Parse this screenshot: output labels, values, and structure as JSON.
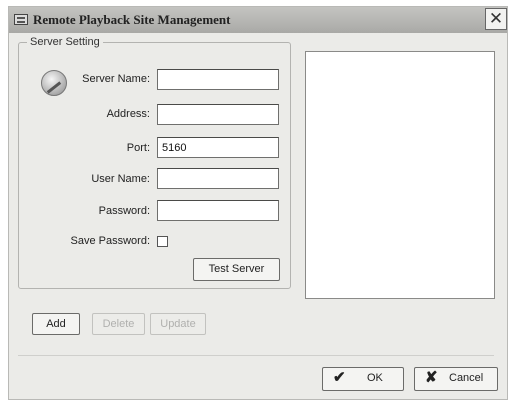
{
  "window": {
    "title": "Remote Playback Site Management",
    "close_glyph": "✕"
  },
  "server_setting": {
    "legend": "Server Setting",
    "icon": "server-globe-icon",
    "fields": {
      "server_name": {
        "label": "Server Name:",
        "value": ""
      },
      "address": {
        "label": "Address:",
        "value": ""
      },
      "port": {
        "label": "Port:",
        "value": "5160"
      },
      "user_name": {
        "label": "User Name:",
        "value": ""
      },
      "password": {
        "label": "Password:",
        "value": ""
      }
    },
    "save_password": {
      "label": "Save Password:",
      "checked": false
    },
    "test_server_label": "Test Server"
  },
  "list_actions": {
    "add_label": "Add",
    "delete_label": "Delete",
    "update_label": "Update"
  },
  "dialog_buttons": {
    "ok_label": "OK",
    "ok_icon": "✔",
    "cancel_label": "Cancel",
    "cancel_icon": "✘"
  }
}
